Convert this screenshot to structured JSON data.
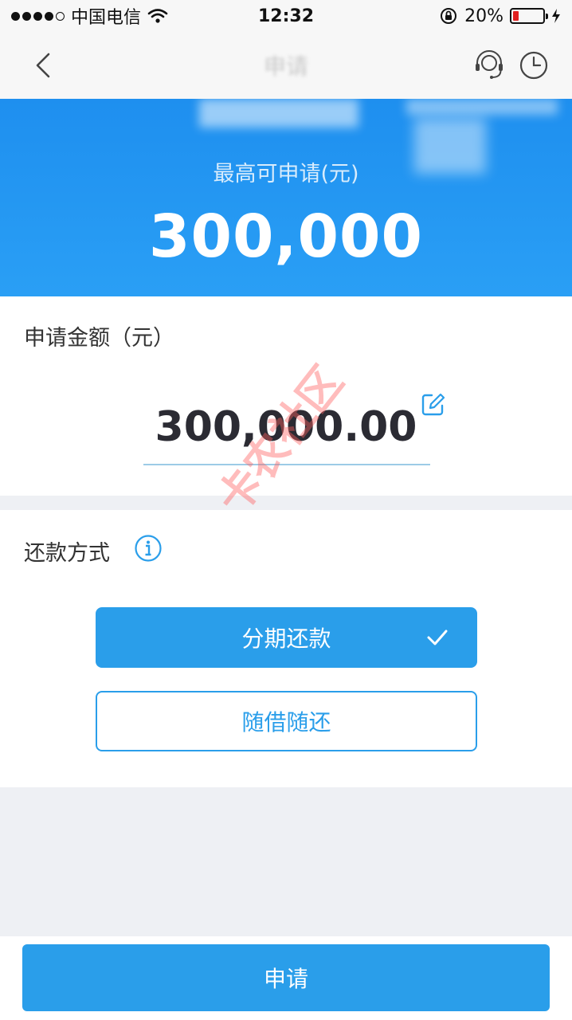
{
  "status_bar": {
    "carrier": "中国电信",
    "time": "12:32",
    "battery_percent": "20%",
    "battery_level": 0.2
  },
  "nav": {
    "title": "申请"
  },
  "hero": {
    "label": "最高可申请(元)",
    "amount": "300,000"
  },
  "amount_section": {
    "label": "申请金额（元）",
    "value": "300,000.00"
  },
  "repayment": {
    "label": "还款方式",
    "options": [
      {
        "label": "分期还款",
        "selected": true
      },
      {
        "label": "随借随还",
        "selected": false
      }
    ]
  },
  "submit": {
    "label": "申请"
  },
  "watermark": {
    "text": "卡农社区"
  },
  "colors": {
    "accent": "#2a9eea",
    "hero_bg": "#1e8fef",
    "page_bg": "#eef0f4",
    "battery_low": "#e02020"
  }
}
